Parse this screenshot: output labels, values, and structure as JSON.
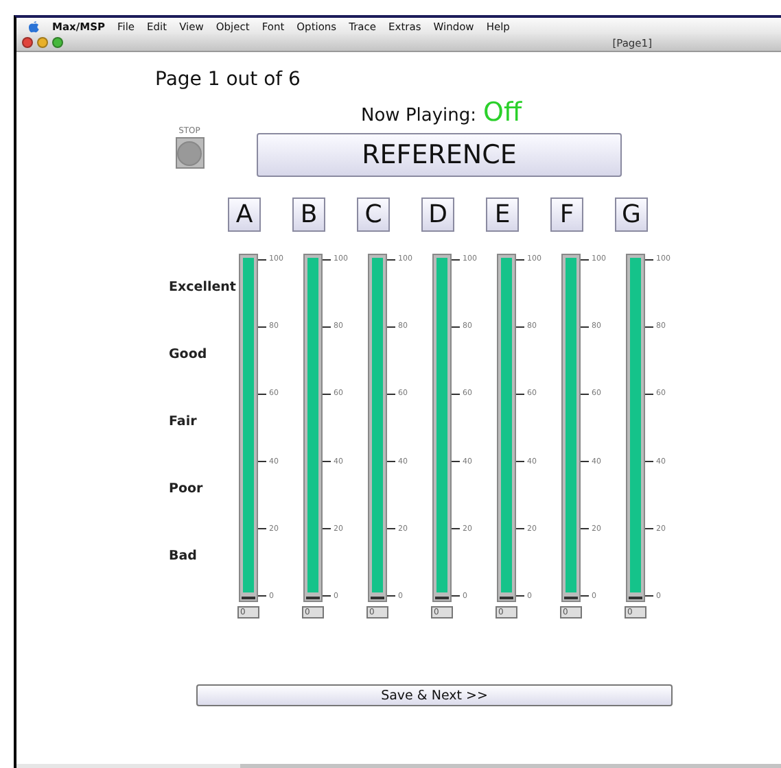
{
  "menu_bar": {
    "app": "Max/MSP",
    "items": [
      "File",
      "Edit",
      "View",
      "Object",
      "Font",
      "Options",
      "Trace",
      "Extras",
      "Window",
      "Help"
    ]
  },
  "window": {
    "title": "[Page1]"
  },
  "page_indicator": "Page 1 out of 6",
  "now_playing": {
    "label": "Now Playing:",
    "value": "Off"
  },
  "stop_button": {
    "label": "STOP"
  },
  "reference_button": "REFERENCE",
  "rating_labels": [
    "Excellent",
    "Good",
    "Fair",
    "Poor",
    "Bad"
  ],
  "samples": [
    {
      "label": "A",
      "ticks": [
        "100",
        "80",
        "60",
        "40",
        "20",
        "0"
      ],
      "value": "0",
      "level": 0
    },
    {
      "label": "B",
      "ticks": [
        "100",
        "80",
        "60",
        "40",
        "20",
        "0"
      ],
      "value": "0",
      "level": 0
    },
    {
      "label": "C",
      "ticks": [
        "100",
        "80",
        "60",
        "40",
        "20",
        "0"
      ],
      "value": "0",
      "level": 0
    },
    {
      "label": "D",
      "ticks": [
        "100",
        "80",
        "60",
        "40",
        "20",
        "0"
      ],
      "value": "0",
      "level": 0
    },
    {
      "label": "E",
      "ticks": [
        "100",
        "80",
        "60",
        "40",
        "20",
        "0"
      ],
      "value": "0",
      "level": 0
    },
    {
      "label": "F",
      "ticks": [
        "100",
        "80",
        "60",
        "40",
        "20",
        "0"
      ],
      "value": "0",
      "level": 0
    },
    {
      "label": "G",
      "ticks": [
        "100",
        "80",
        "60",
        "40",
        "20",
        "0"
      ],
      "value": "0",
      "level": 0
    }
  ],
  "save_button": "Save & Next >>"
}
